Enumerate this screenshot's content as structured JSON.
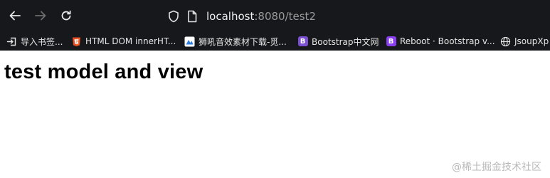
{
  "browser": {
    "url_host": "localhost",
    "url_rest": ":8080/test2"
  },
  "bookmarks": [
    {
      "label": "导入书签...",
      "icon": "import-icon"
    },
    {
      "label": "HTML DOM innerHT...",
      "icon": "html-logo-icon"
    },
    {
      "label": "狮吼音效素材下载-觅...",
      "icon": "site-logo-icon"
    },
    {
      "label": "Bootstrap中文网",
      "icon": "bootstrap-icon"
    },
    {
      "label": "Reboot · Bootstrap v...",
      "icon": "bootstrap-icon"
    },
    {
      "label": "JsoupXp",
      "icon": "globe-icon"
    }
  ],
  "page": {
    "heading": "test model and view"
  },
  "watermark": "@稀土掘金技术社区",
  "colors": {
    "chrome_bg": "#16181c",
    "bootstrap_purple": "#7b4fd1",
    "html_logo_red": "#e44d26"
  }
}
